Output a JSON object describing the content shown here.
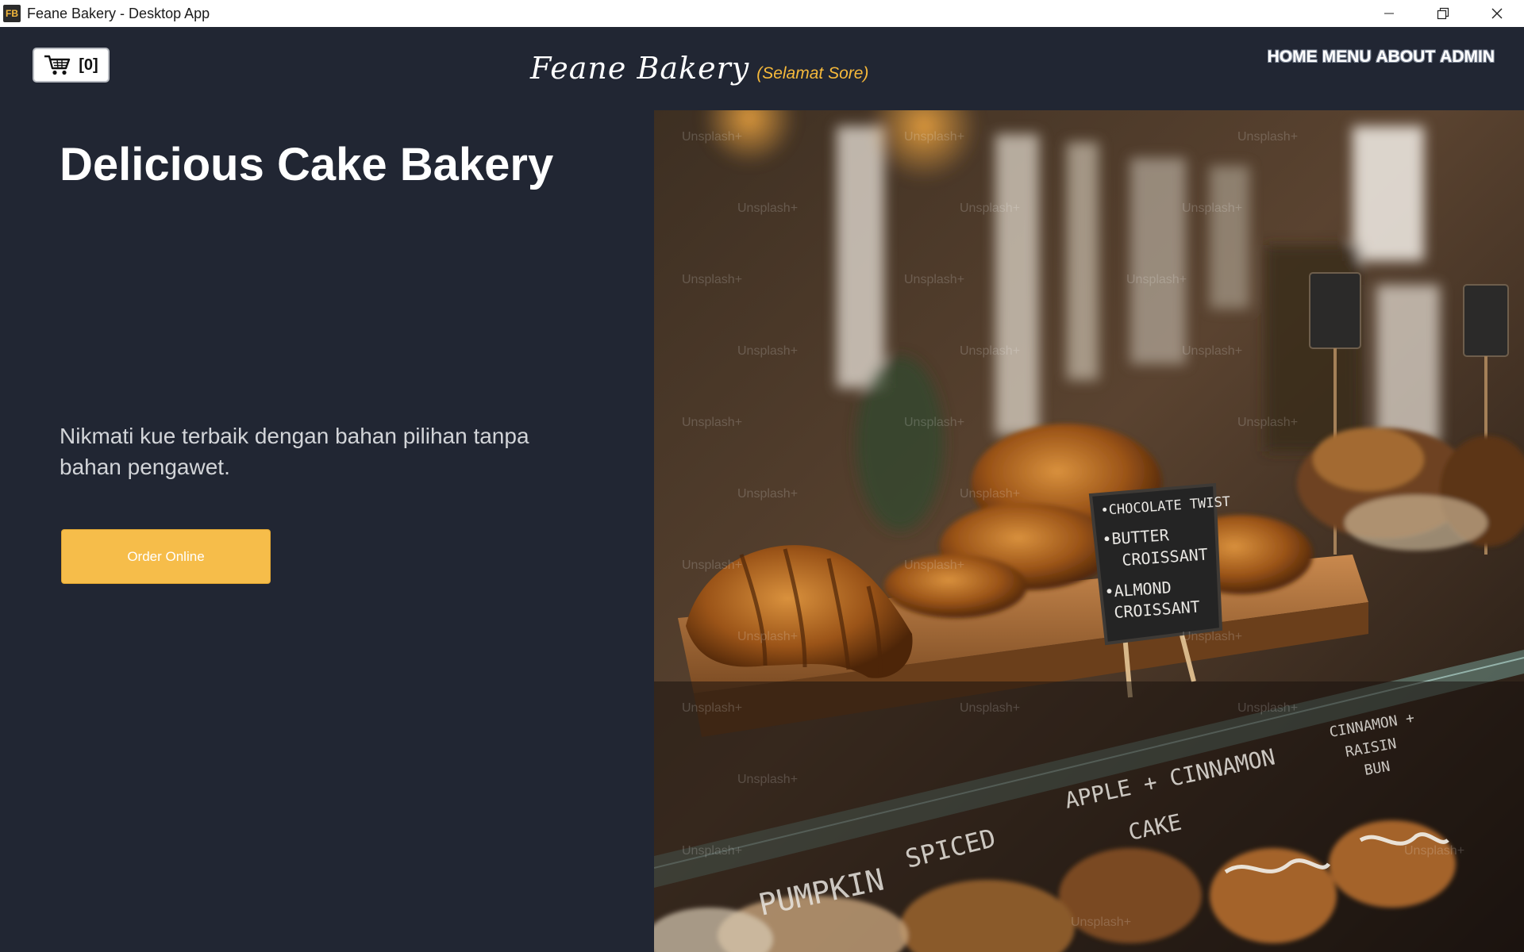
{
  "window": {
    "title": "Feane Bakery - Desktop App",
    "icon_text": "FB"
  },
  "header": {
    "cart_count": "[0]",
    "brand_name": "Feane Bakery",
    "greeting": "(Selamat Sore)",
    "nav": [
      "HOME",
      "MENU",
      "ABOUT",
      "ADMIN"
    ]
  },
  "hero": {
    "title": "Delicious Cake Bakery",
    "description": "Nikmati kue terbaik dengan bahan pilihan tanpa bahan pengawet.",
    "order_button": "Order Online"
  },
  "photo": {
    "chalkboard_lines": [
      "•CHOCOLATE TWIST",
      "•BUTTER",
      "CROISSANT",
      "•ALMOND",
      "CROISSANT"
    ],
    "glass_labels": [
      "APPLE + CINNAMON",
      "CAKE",
      "CINNAMON +",
      "RAISIN",
      "BUN",
      "PUMPKIN",
      "SPICED"
    ],
    "watermark": "Unsplash+"
  },
  "colors": {
    "background": "#212633",
    "accent": "#f6b93b",
    "button": "#f6bd4a"
  }
}
